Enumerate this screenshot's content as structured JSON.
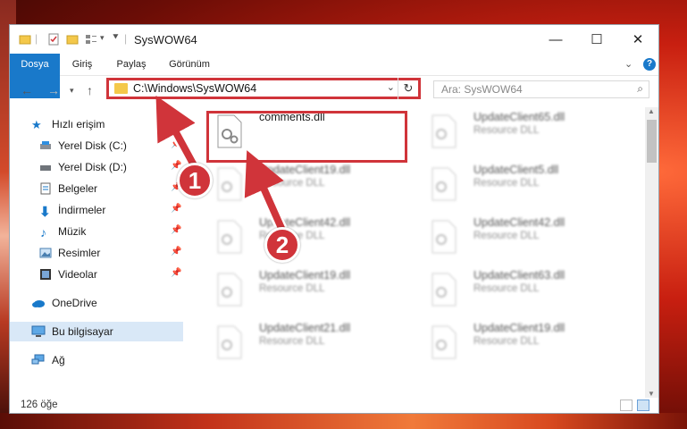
{
  "window": {
    "title": "SysWOW64"
  },
  "ribbon": {
    "tabs": [
      "Dosya",
      "Giriş",
      "Paylaş",
      "Görünüm"
    ]
  },
  "address_bar": {
    "path": "C:\\Windows\\SysWOW64"
  },
  "search": {
    "placeholder": "Ara: SysWOW64"
  },
  "sidebar": {
    "items": [
      {
        "label": "Hızlı erişim",
        "icon": "star-icon"
      },
      {
        "label": "Yerel Disk (C:)",
        "icon": "drive-icon"
      },
      {
        "label": "Yerel Disk (D:)",
        "icon": "drive-icon"
      },
      {
        "label": "Belgeler",
        "icon": "document-icon"
      },
      {
        "label": "İndirmeler",
        "icon": "download-icon"
      },
      {
        "label": "Müzik",
        "icon": "music-icon"
      },
      {
        "label": "Resimler",
        "icon": "pictures-icon"
      },
      {
        "label": "Videolar",
        "icon": "video-icon"
      },
      {
        "label": "OneDrive",
        "icon": "cloud-icon"
      },
      {
        "label": "Bu bilgisayar",
        "icon": "computer-icon"
      },
      {
        "label": "Ağ",
        "icon": "network-icon"
      }
    ]
  },
  "files": [
    {
      "name": "comments.dll",
      "type": ""
    },
    {
      "name": "UpdateClient65.dll",
      "type": "Resource DLL"
    },
    {
      "name": "UpdateClient19.dll",
      "type": "Resource DLL"
    },
    {
      "name": "UpdateClient5.dll",
      "type": "Resource DLL"
    },
    {
      "name": "UpdateClient42.dll",
      "type": "Resource DLL"
    },
    {
      "name": "UpdateClient42.dll",
      "type": "Resource DLL"
    },
    {
      "name": "UpdateClient19.dll",
      "type": "Resource DLL"
    },
    {
      "name": "UpdateClient63.dll",
      "type": "Resource DLL"
    },
    {
      "name": "UpdateClient21.dll",
      "type": "Resource DLL"
    },
    {
      "name": "UpdateClient19.dll",
      "type": "Resource DLL"
    }
  ],
  "status": {
    "item_count": "126 öğe"
  },
  "annotations": {
    "step1": "1",
    "step2": "2"
  },
  "colors": {
    "accent": "#1979ca",
    "highlight": "#d0343a"
  }
}
